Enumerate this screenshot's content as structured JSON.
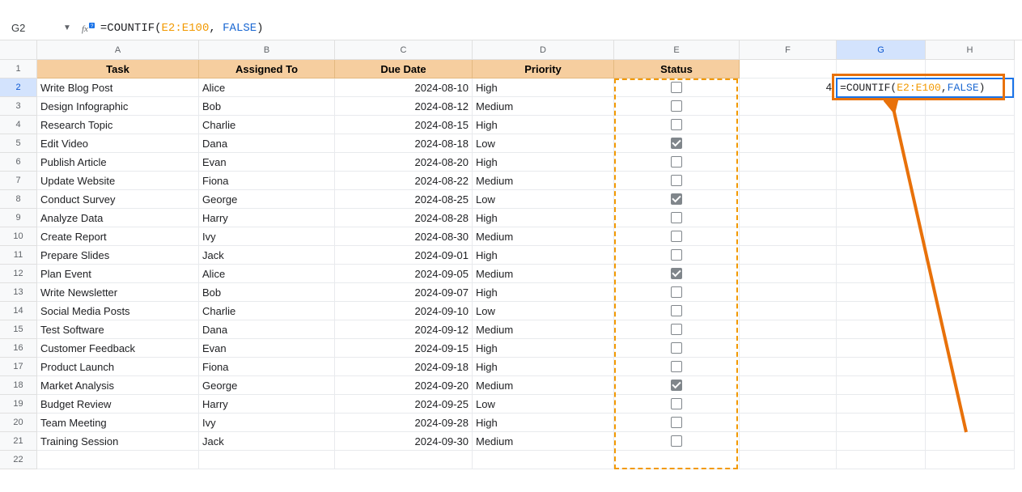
{
  "formula_bar": {
    "cell_ref": "G2",
    "fn": "=COUNTIF",
    "open": "(",
    "range": "E2:E100",
    "comma": ", ",
    "keyword": "FALSE",
    "close": ")"
  },
  "columns": [
    "A",
    "B",
    "C",
    "D",
    "E",
    "F",
    "G",
    "H"
  ],
  "headers": {
    "task": "Task",
    "assigned": "Assigned To",
    "due": "Due Date",
    "priority": "Priority",
    "status": "Status"
  },
  "rows": [
    {
      "task": "Write Blog Post",
      "assigned": "Alice",
      "due": "2024-08-10",
      "priority": "High",
      "checked": false
    },
    {
      "task": "Design Infographic",
      "assigned": "Bob",
      "due": "2024-08-12",
      "priority": "Medium",
      "checked": false
    },
    {
      "task": "Research Topic",
      "assigned": "Charlie",
      "due": "2024-08-15",
      "priority": "High",
      "checked": false
    },
    {
      "task": "Edit Video",
      "assigned": "Dana",
      "due": "2024-08-18",
      "priority": "Low",
      "checked": true
    },
    {
      "task": "Publish Article",
      "assigned": "Evan",
      "due": "2024-08-20",
      "priority": "High",
      "checked": false
    },
    {
      "task": "Update Website",
      "assigned": "Fiona",
      "due": "2024-08-22",
      "priority": "Medium",
      "checked": false
    },
    {
      "task": "Conduct Survey",
      "assigned": "George",
      "due": "2024-08-25",
      "priority": "Low",
      "checked": true
    },
    {
      "task": "Analyze Data",
      "assigned": "Harry",
      "due": "2024-08-28",
      "priority": "High",
      "checked": false
    },
    {
      "task": "Create Report",
      "assigned": "Ivy",
      "due": "2024-08-30",
      "priority": "Medium",
      "checked": false
    },
    {
      "task": "Prepare Slides",
      "assigned": "Jack",
      "due": "2024-09-01",
      "priority": "High",
      "checked": false
    },
    {
      "task": "Plan Event",
      "assigned": "Alice",
      "due": "2024-09-05",
      "priority": "Medium",
      "checked": true
    },
    {
      "task": "Write Newsletter",
      "assigned": "Bob",
      "due": "2024-09-07",
      "priority": "High",
      "checked": false
    },
    {
      "task": "Social Media Posts",
      "assigned": "Charlie",
      "due": "2024-09-10",
      "priority": "Low",
      "checked": false
    },
    {
      "task": "Test Software",
      "assigned": "Dana",
      "due": "2024-09-12",
      "priority": "Medium",
      "checked": false
    },
    {
      "task": "Customer Feedback",
      "assigned": "Evan",
      "due": "2024-09-15",
      "priority": "High",
      "checked": false
    },
    {
      "task": "Product Launch",
      "assigned": "Fiona",
      "due": "2024-09-18",
      "priority": "High",
      "checked": false
    },
    {
      "task": "Market Analysis",
      "assigned": "George",
      "due": "2024-09-20",
      "priority": "Medium",
      "checked": true
    },
    {
      "task": "Budget Review",
      "assigned": "Harry",
      "due": "2024-09-25",
      "priority": "Low",
      "checked": false
    },
    {
      "task": "Team Meeting",
      "assigned": "Ivy",
      "due": "2024-09-28",
      "priority": "High",
      "checked": false
    },
    {
      "task": "Training Session",
      "assigned": "Jack",
      "due": "2024-09-30",
      "priority": "Medium",
      "checked": false
    }
  ],
  "preview_result": "4",
  "edit_cell": {
    "eq": "=",
    "fn": "COUNTIF",
    "open": "(",
    "range": "E2:E100",
    "comma": ", ",
    "keyword": "FALSE",
    "close": ")"
  },
  "chart_data": {
    "type": "table",
    "title": "",
    "columns": [
      "Task",
      "Assigned To",
      "Due Date",
      "Priority",
      "Status"
    ],
    "records": [
      [
        "Write Blog Post",
        "Alice",
        "2024-08-10",
        "High",
        false
      ],
      [
        "Design Infographic",
        "Bob",
        "2024-08-12",
        "Medium",
        false
      ],
      [
        "Research Topic",
        "Charlie",
        "2024-08-15",
        "High",
        false
      ],
      [
        "Edit Video",
        "Dana",
        "2024-08-18",
        "Low",
        true
      ],
      [
        "Publish Article",
        "Evan",
        "2024-08-20",
        "High",
        false
      ],
      [
        "Update Website",
        "Fiona",
        "2024-08-22",
        "Medium",
        false
      ],
      [
        "Conduct Survey",
        "George",
        "2024-08-25",
        "Low",
        true
      ],
      [
        "Analyze Data",
        "Harry",
        "2024-08-28",
        "High",
        false
      ],
      [
        "Create Report",
        "Ivy",
        "2024-08-30",
        "Medium",
        false
      ],
      [
        "Prepare Slides",
        "Jack",
        "2024-09-01",
        "High",
        false
      ],
      [
        "Plan Event",
        "Alice",
        "2024-09-05",
        "Medium",
        true
      ],
      [
        "Write Newsletter",
        "Bob",
        "2024-09-07",
        "High",
        false
      ],
      [
        "Social Media Posts",
        "Charlie",
        "2024-09-10",
        "Low",
        false
      ],
      [
        "Test Software",
        "Dana",
        "2024-09-12",
        "Medium",
        false
      ],
      [
        "Customer Feedback",
        "Evan",
        "2024-09-15",
        "High",
        false
      ],
      [
        "Product Launch",
        "Fiona",
        "2024-09-18",
        "High",
        false
      ],
      [
        "Market Analysis",
        "George",
        "2024-09-20",
        "Medium",
        true
      ],
      [
        "Budget Review",
        "Harry",
        "2024-09-25",
        "Low",
        false
      ],
      [
        "Team Meeting",
        "Ivy",
        "2024-09-28",
        "High",
        false
      ],
      [
        "Training Session",
        "Jack",
        "2024-09-30",
        "Medium",
        false
      ]
    ],
    "formula_cell": {
      "address": "G2",
      "formula": "=COUNTIF(E2:E100, FALSE)",
      "preview_result": 4
    }
  }
}
